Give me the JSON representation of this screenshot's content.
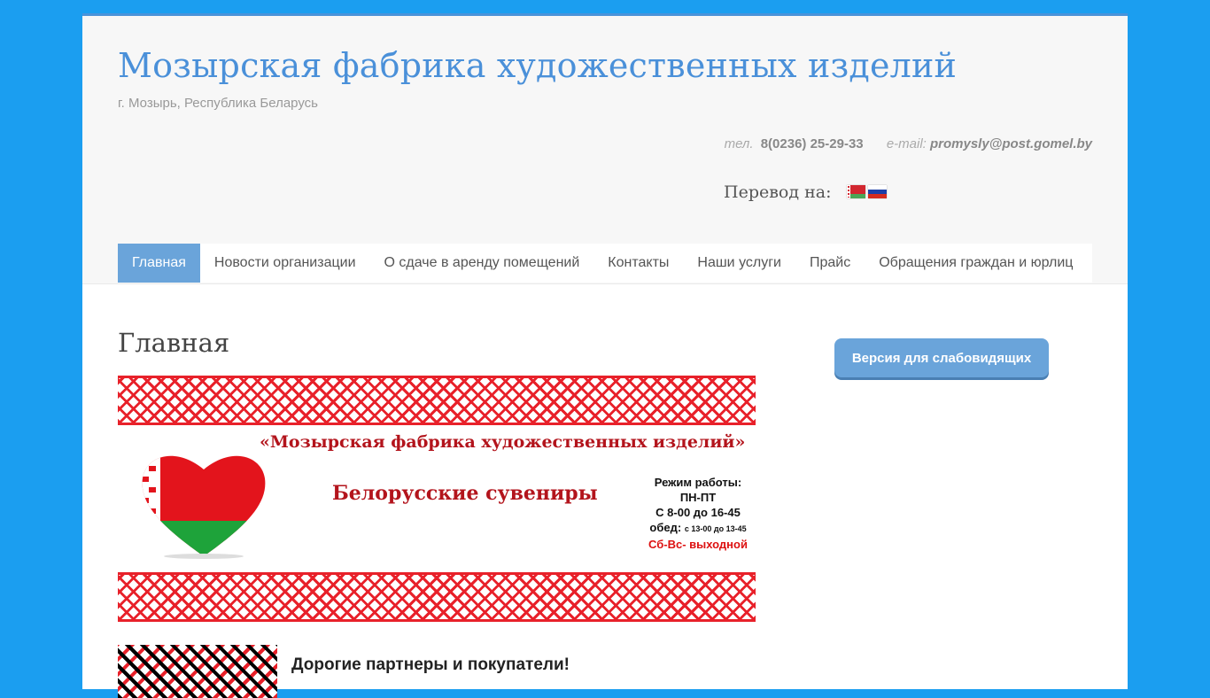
{
  "header": {
    "title": "Мозырская фабрика художественных изделий",
    "description": "г. Мозырь, Республика Беларусь",
    "phone_label": "тел.",
    "phone": "8(0236) 25-29-33",
    "email_label": "e-mail",
    "email": "promysly@post.gomel.by",
    "translate_label": "Перевод на:",
    "flags": [
      "belarus-flag-icon",
      "russia-flag-icon"
    ]
  },
  "nav": {
    "items": [
      {
        "label": "Главная",
        "active": true
      },
      {
        "label": "Новости организации"
      },
      {
        "label": "О сдаче в аренду помещений"
      },
      {
        "label": "Контакты"
      },
      {
        "label": "Наши услуги"
      },
      {
        "label": "Прайс"
      },
      {
        "label": "Обращения граждан и юрлиц"
      }
    ]
  },
  "main": {
    "title": "Главная",
    "banner": {
      "title": "«Мозырская фабрика художественных изделий»",
      "subtitle": "Белорусские сувениры",
      "hours_title": "Режим работы:",
      "hours_days": "ПН-ПТ",
      "hours_time": "С 8-00 до 16-45",
      "lunch_label": "обед:",
      "lunch_time": "с 13-00 до 13-45",
      "weekend": "Сб-Вс- выходной"
    },
    "banner2_text": "Дорогие партнеры и покупатели!"
  },
  "sidebar": {
    "vision_button": "Версия для слабовидящих"
  },
  "colors": {
    "background": "#1b9ef0",
    "title": "#4a90d9",
    "nav_active": "#6aa4da",
    "ornament_red": "#e8212a"
  }
}
